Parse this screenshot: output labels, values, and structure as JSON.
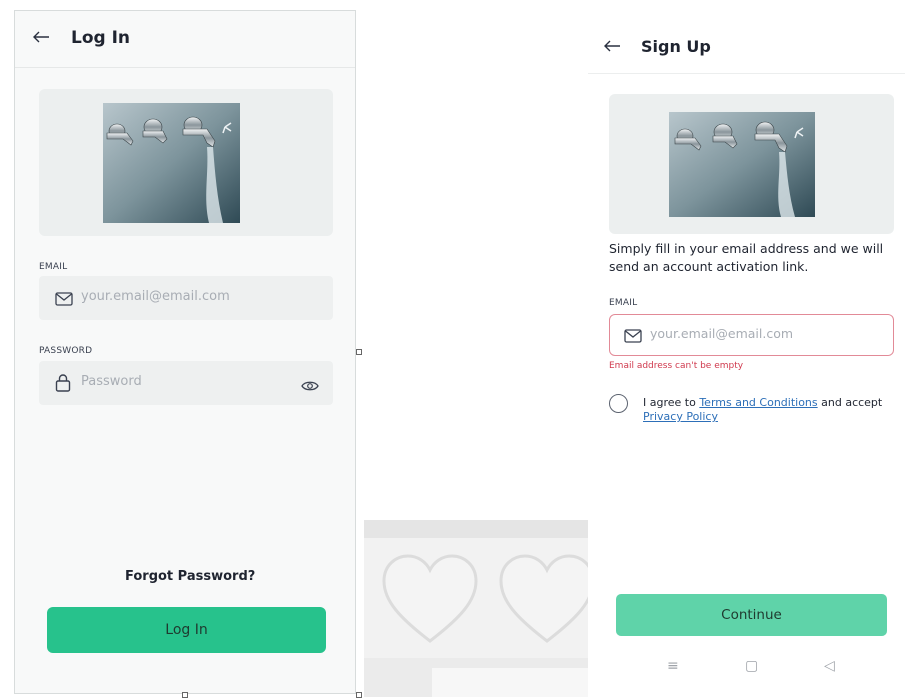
{
  "login_screen": {
    "back_icon": "arrow-left-icon",
    "title": "Log In",
    "email_label": "EMAIL",
    "email_placeholder": "your.email@email.com",
    "password_label": "PASSWORD",
    "password_placeholder": "Password",
    "forgot_password": "Forgot Password?",
    "login_button": "Log In",
    "accent_color": "#27c28c"
  },
  "signup_screen": {
    "back_icon": "arrow-left-icon",
    "title": "Sign Up",
    "description": "Simply fill in your email address and we will send an account activation link.",
    "email_label": "EMAIL",
    "email_placeholder": "your.email@email.com",
    "email_error": "Email address can't be empty",
    "agree_prefix": "I agree to ",
    "terms_link": "Terms and Conditions",
    "agree_middle": " and accept ",
    "privacy_link": "Privacy Policy",
    "continue_button": "Continue",
    "accent_color": "#5fd3a9",
    "error_color": "#d03a4e"
  },
  "nav_bar": {
    "menu_icon": "≡",
    "home_icon": "▢",
    "back_icon": "◁"
  }
}
